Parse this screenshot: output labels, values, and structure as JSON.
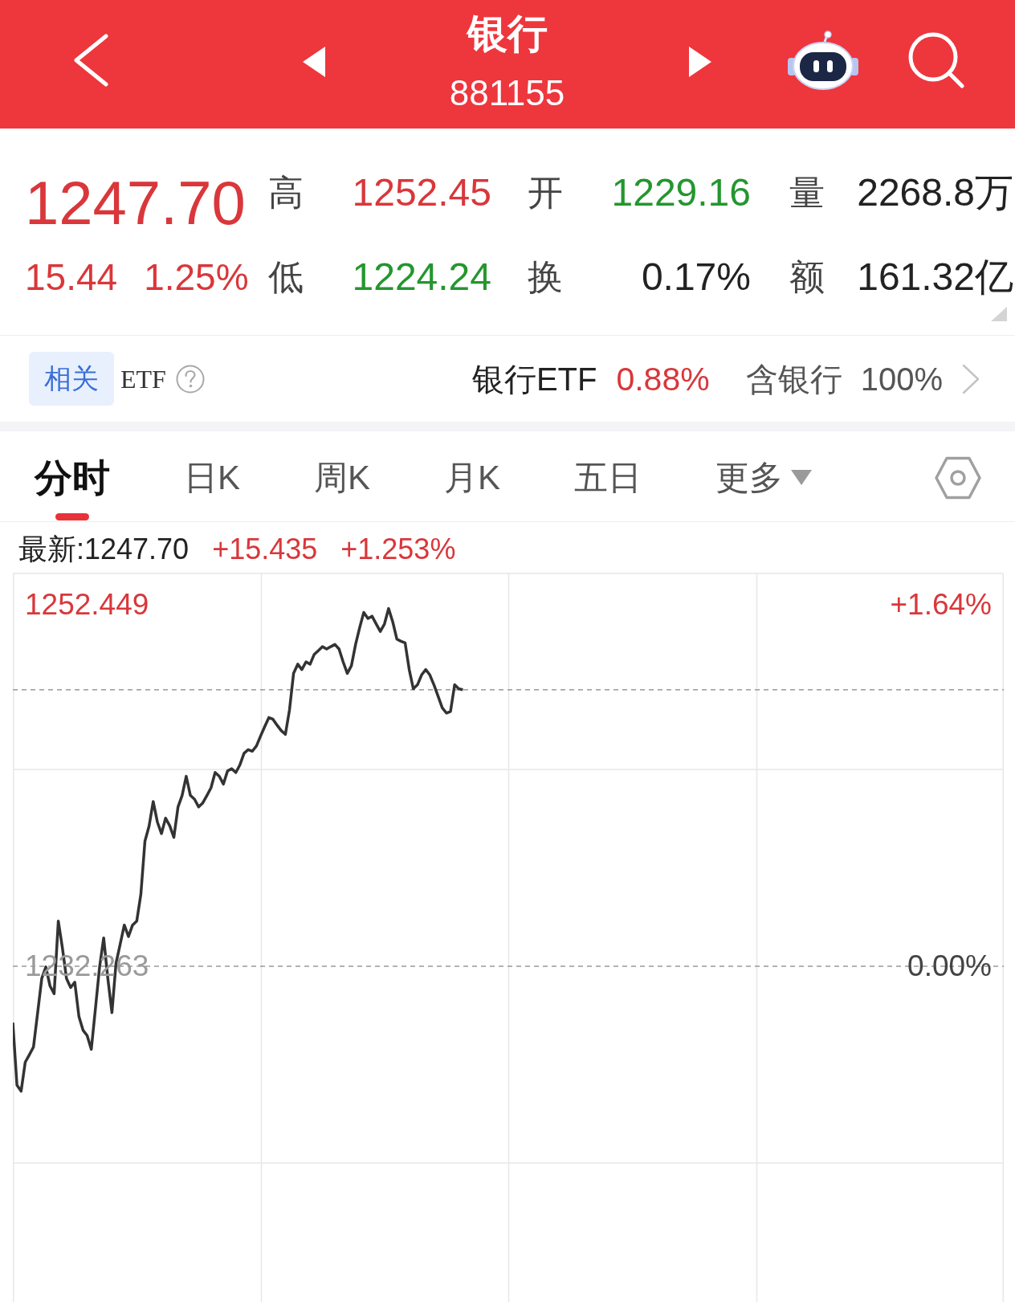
{
  "header": {
    "title": "银行",
    "code": "881155"
  },
  "quote": {
    "price": "1247.70",
    "change": "15.44",
    "change_pct": "1.25%",
    "stats": [
      {
        "label": "高",
        "value": "1252.45",
        "color": "#d9373b"
      },
      {
        "label": "开",
        "value": "1229.16",
        "color": "#24962f"
      },
      {
        "label": "量",
        "value": "2268.8万",
        "color": "#222222"
      },
      {
        "label": "低",
        "value": "1224.24",
        "color": "#24962f"
      },
      {
        "label": "换",
        "value": "0.17%",
        "color": "#222222"
      },
      {
        "label": "额",
        "value": "161.32亿",
        "color": "#222222"
      }
    ]
  },
  "etf": {
    "tag": "相关",
    "label": "ETF",
    "fund_name": "银行ETF",
    "fund_change": "0.88%",
    "holding_label": "含银行",
    "holding": "100%"
  },
  "tabs": [
    {
      "label": "分时",
      "selected": true,
      "kind": "plain"
    },
    {
      "label": "日K",
      "selected": false,
      "kind": "plain"
    },
    {
      "label": "周K",
      "selected": false,
      "kind": "plain"
    },
    {
      "label": "月K",
      "selected": false,
      "kind": "plain"
    },
    {
      "label": "五日",
      "selected": false,
      "kind": "plain"
    },
    {
      "label": "更多",
      "selected": false,
      "kind": "dropdown"
    }
  ],
  "chart": {
    "latest": "最新:1247.70",
    "change": "+15.435",
    "change_pct": "+1.253%",
    "percent_ticks": [
      "+1.64%",
      "0.00%"
    ],
    "chart_data": {
      "type": "line",
      "ylim": [
        1213.51,
        1254.24
      ],
      "yticks": [
        {
          "value": 1252.449,
          "label": "1252.449"
        },
        {
          "value": 1232.263,
          "label": "1232.263"
        }
      ],
      "ref_lines": [
        {
          "axis": "y",
          "value": 1232.263
        },
        {
          "axis": "y",
          "value": 1247.7
        }
      ],
      "series": [
        {
          "color": "#333333",
          "values": [
            1229.11,
            1225.62,
            1225.28,
            1226.9,
            1227.32,
            1227.75,
            1229.67,
            1231.58,
            1232.22,
            1231.16,
            1230.73,
            1234.78,
            1233.29,
            1231.58,
            1231.07,
            1231.37,
            1229.45,
            1228.69,
            1228.39,
            1227.62,
            1229.88,
            1232.22,
            1233.84,
            1231.58,
            1229.67,
            1232.43,
            1233.5,
            1234.56,
            1233.92,
            1234.56,
            1234.78,
            1236.27,
            1239.25,
            1240.1,
            1241.46,
            1240.31,
            1239.67,
            1240.53,
            1240.1,
            1239.46,
            1241.16,
            1241.8,
            1242.87,
            1241.8,
            1241.59,
            1241.16,
            1241.38,
            1241.8,
            1242.23,
            1243.08,
            1242.87,
            1242.44,
            1243.17,
            1243.29,
            1243.08,
            1243.51,
            1244.15,
            1244.36,
            1244.27,
            1244.57,
            1245.12,
            1245.64,
            1246.15,
            1246.06,
            1245.72,
            1245.42,
            1245.21,
            1246.57,
            1248.62,
            1249.13,
            1248.83,
            1249.26,
            1249.13,
            1249.68,
            1249.89,
            1250.11,
            1249.98,
            1250.11,
            1250.23,
            1249.98,
            1249.26,
            1248.62,
            1249.04,
            1250.23,
            1251.17,
            1252.02,
            1251.68,
            1251.81,
            1251.38,
            1250.96,
            1251.38,
            1252.24,
            1251.51,
            1250.53,
            1250.41,
            1250.32,
            1248.83,
            1247.76,
            1247.98,
            1248.53,
            1248.83,
            1248.53,
            1247.98,
            1247.34,
            1246.7,
            1246.4,
            1246.49,
            1247.98,
            1247.76,
            1247.7,
            null,
            null,
            null,
            null,
            null,
            null,
            null,
            null,
            null,
            null,
            null,
            null,
            null,
            null,
            null,
            null,
            null,
            null,
            null,
            null,
            null,
            null,
            null,
            null,
            null,
            null,
            null,
            null,
            null,
            null,
            null,
            null,
            null,
            null,
            null,
            null,
            null,
            null,
            null,
            null,
            null,
            null,
            null,
            null,
            null,
            null,
            null,
            null,
            null,
            null,
            null,
            null,
            null,
            null,
            null,
            null,
            null,
            null,
            null,
            null,
            null,
            null,
            null,
            null,
            null,
            null,
            null,
            null,
            null,
            null,
            null,
            null,
            null,
            null,
            null,
            null,
            null,
            null,
            null,
            null,
            null,
            null,
            null,
            null,
            null,
            null,
            null,
            null,
            null,
            null,
            null,
            null,
            null,
            null,
            null,
            null,
            null,
            null,
            null,
            null,
            null,
            null,
            null,
            null,
            null,
            null,
            null,
            null,
            null,
            null,
            null,
            null,
            null,
            null,
            null,
            null,
            null,
            null,
            null,
            null,
            null,
            null,
            null,
            null,
            null,
            null,
            null,
            null,
            null,
            null,
            null
          ]
        }
      ]
    }
  }
}
